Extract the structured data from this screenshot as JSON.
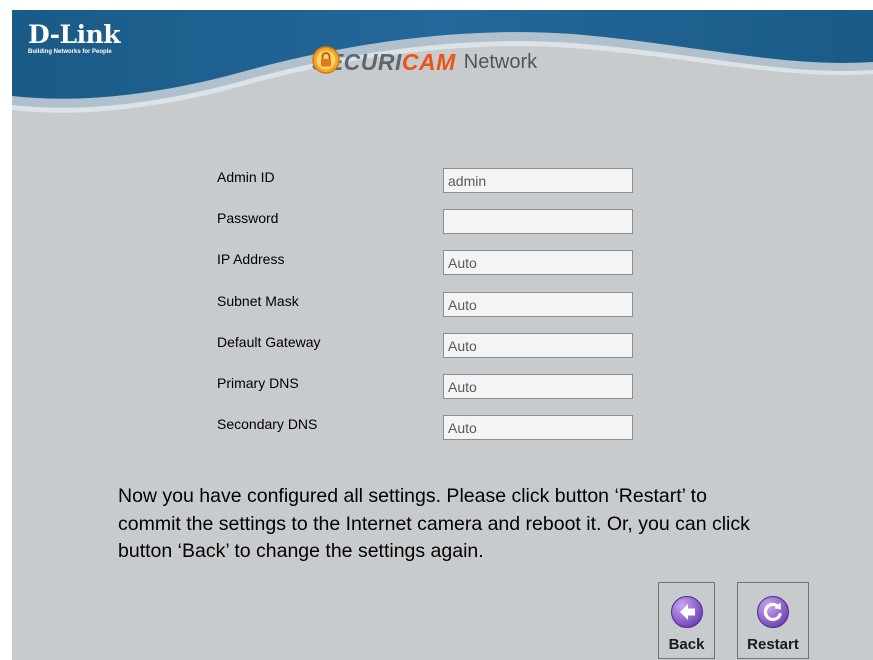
{
  "header": {
    "brand_name": "D-Link",
    "brand_tagline": "Building Networks for People",
    "product_word1": "SECURI",
    "product_word2": "CAM",
    "product_word3": "Network",
    "colors": {
      "banner": "#1f5f8b",
      "banner_dark": "#0f4a75",
      "accent": "#e8541a"
    }
  },
  "form": {
    "admin_id": {
      "label": "Admin ID",
      "value": "admin"
    },
    "password": {
      "label": "Password",
      "value": ""
    },
    "ip_address": {
      "label": "IP Address",
      "value": "Auto"
    },
    "subnet_mask": {
      "label": "Subnet Mask",
      "value": "Auto"
    },
    "default_gateway": {
      "label": "Default Gateway",
      "value": "Auto"
    },
    "primary_dns": {
      "label": "Primary DNS",
      "value": "Auto"
    },
    "secondary_dns": {
      "label": "Secondary DNS",
      "value": "Auto"
    }
  },
  "message": "Now you have configured all settings. Please click button ‘Restart’ to commit the settings to the Internet camera and reboot it. Or, you can click button ‘Back’ to change the settings again.",
  "buttons": {
    "back": {
      "label": "Back",
      "icon": "arrow-left-icon"
    },
    "restart": {
      "label": "Restart",
      "icon": "refresh-icon"
    }
  }
}
